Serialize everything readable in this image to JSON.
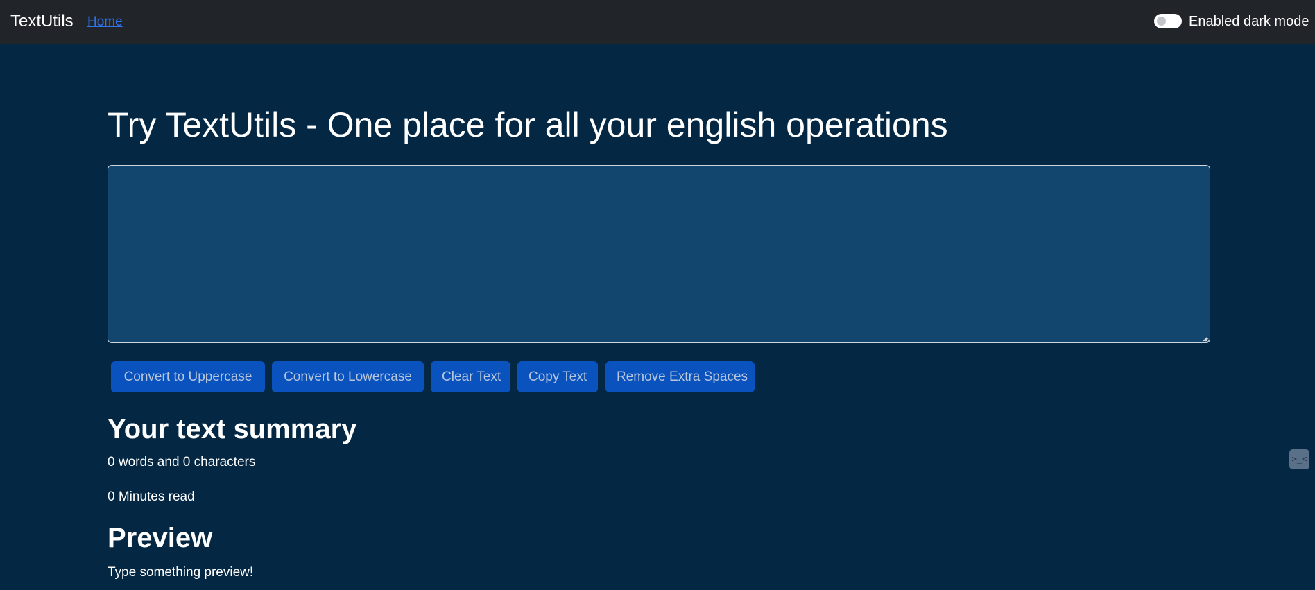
{
  "navbar": {
    "brand": "TextUtils",
    "links": [
      {
        "label": "Home"
      }
    ],
    "dark_mode_label": "Enabled dark mode"
  },
  "main": {
    "heading": "Try TextUtils - One place for all your english operations",
    "textarea_value": "",
    "buttons": {
      "uppercase": "Convert to Uppercase",
      "lowercase": "Convert to Lowercase",
      "clear": "Clear Text",
      "copy": "Copy Text",
      "remove_spaces": "Remove Extra Spaces"
    }
  },
  "summary": {
    "heading": "Your text summary",
    "words_chars": "0 words and 0 characters",
    "minutes_read": "0 Minutes read"
  },
  "preview": {
    "heading": "Preview",
    "text": "Type something preview!"
  },
  "side_widget": {
    "icon": "extension-face-icon",
    "glyph": ">_<"
  },
  "colors": {
    "body_bg": "#042743",
    "navbar_bg": "#212529",
    "textarea_bg": "#13466e",
    "button_bg": "#0a53be",
    "link": "#2f74f0"
  }
}
